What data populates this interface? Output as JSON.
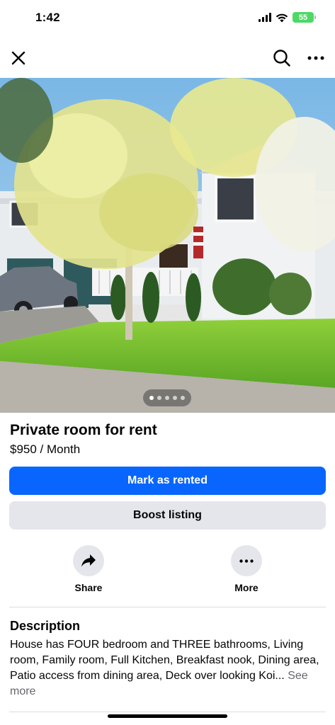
{
  "status_bar": {
    "time": "1:42",
    "battery": "55"
  },
  "nav": {
    "close_icon": "close-icon",
    "search_icon": "search-icon",
    "more_icon": "more-icon"
  },
  "photo": {
    "pager_count": 5,
    "pager_active": 2
  },
  "listing": {
    "title": "Private room for rent",
    "price": "$950 / Month"
  },
  "buttons": {
    "mark_rented": "Mark as rented",
    "boost": "Boost listing"
  },
  "actions": {
    "share": "Share",
    "more": "More"
  },
  "description": {
    "heading": "Description",
    "body": "House has FOUR bedroom and THREE bathrooms, Living room, Family room, Full Kitchen, Breakfast nook, Dining area, Patio access from dining area, Deck over looking Koi...",
    "see_more": "See more"
  },
  "colors": {
    "primary": "#0866ff",
    "secondary_bg": "#e4e6eb",
    "battery": "#4cd964"
  }
}
